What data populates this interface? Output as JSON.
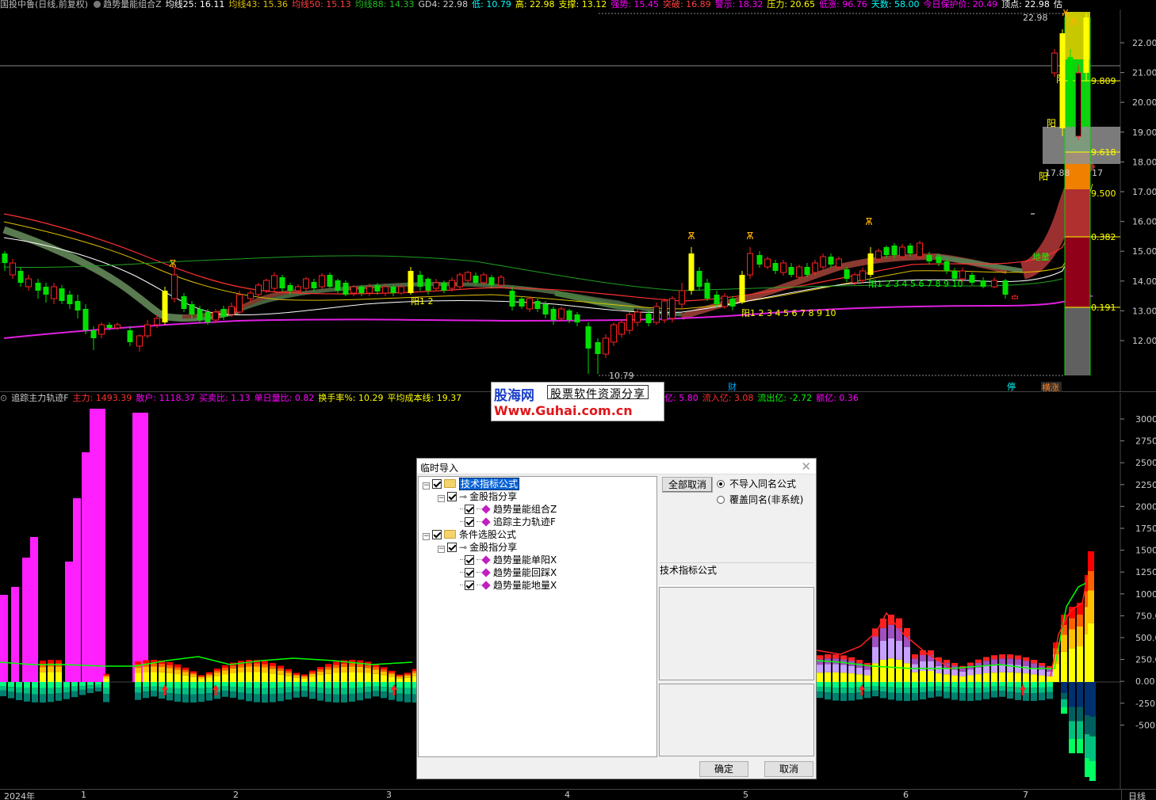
{
  "header": {
    "stock": "国投中鲁(日线,前复权)",
    "indicator": "趋势量能组合Z",
    "ma25": "均线25: 16.11",
    "ma43": "均线43: 15.36",
    "ma50": "均线50: 15.13",
    "ma88": "均线88: 14.33",
    "gd4": "GD4: 22.98",
    "low": "低: 10.79",
    "high": "高: 22.98",
    "support": "支撑: 13.12",
    "strong": "强势: 15.45",
    "breakout": "突破: 16.89",
    "warn": "警示: 18.32",
    "pressure": "压力: 20.65",
    "rise": "低涨: 96.76",
    "days": "天数: 58.00",
    "protect": "今日保护价: 20.49",
    "top": "顶点: 22.98",
    "tail": "估"
  },
  "price_axis": [
    "22.00",
    "21.00",
    "20.00",
    "19.00",
    "18.00",
    "17.00",
    "16.00",
    "15.00",
    "14.00",
    "13.00",
    "12.00"
  ],
  "fib_labels": [
    "9.809",
    "9.618",
    "9.500",
    "0.382",
    "0.191"
  ],
  "chart_labels": {
    "high_mark": "22.98",
    "low_mark": "10.79",
    "fib_17_88": "17.88",
    "fib_17": "17",
    "yang": "阳",
    "yang12": "阳1 2",
    "count1": "阳1 2 3 4 5 6 7 8 9 10",
    "count2": "阳1 2 3 4 5 6 7 8 9 10",
    "diliang": "地量",
    "cai": "财",
    "ting": "停",
    "zhangting": "横涨"
  },
  "ind_header": {
    "name": "追踪主力轨迹F",
    "main": "主力: 1493.39",
    "retail": "散户: 1118.37",
    "ratio": "买卖比: 1.13",
    "daily": "单日量比: 0.82",
    "turnover": "换手率%: 10.29",
    "avgcost": "平均成本线: 19.37",
    "tail": "亿: 5.80",
    "inflow": "流入亿: 3.08",
    "outflow": "流出亿: -2.72",
    "amount": "额亿: 0.36"
  },
  "vol_axis": [
    "3000.",
    "2750.",
    "2500.",
    "2250.",
    "2000.",
    "1750.",
    "1500.",
    "1250.",
    "1000.",
    "750.0",
    "500.0",
    "250.0",
    "0.00",
    "-250.",
    "-500."
  ],
  "date_axis": {
    "year": "2024年",
    "m1": "1",
    "m2": "2",
    "m3": "3",
    "m4": "4",
    "m5": "5",
    "m6": "6",
    "m7": "7",
    "period": "日线"
  },
  "watermark": {
    "cn": "股海网",
    "tag": "股票软件资源分享",
    "url": "Www.Guhai.com.cn"
  },
  "dialog": {
    "title": "临时导入",
    "tree": {
      "root1": "技术指标公式",
      "group1": "金股指分享",
      "item1": "趋势量能组合Z",
      "item2": "追踪主力轨迹F",
      "root2": "条件选股公式",
      "group2": "金股指分享",
      "item3": "趋势量能单阳X",
      "item4": "趋势量能回踩X",
      "item5": "趋势量能地量X"
    },
    "cancel_all": "全部取消",
    "radio1": "不导入同名公式",
    "radio2": "覆盖同名(非系统)",
    "panel_label": "技术指标公式",
    "ok": "确定",
    "cancel": "取消"
  },
  "colors": {
    "up": "#ff3030",
    "down": "#00d0c0",
    "yellow": "#ffff00",
    "magenta": "#ff00ff",
    "green": "#00ff00"
  }
}
